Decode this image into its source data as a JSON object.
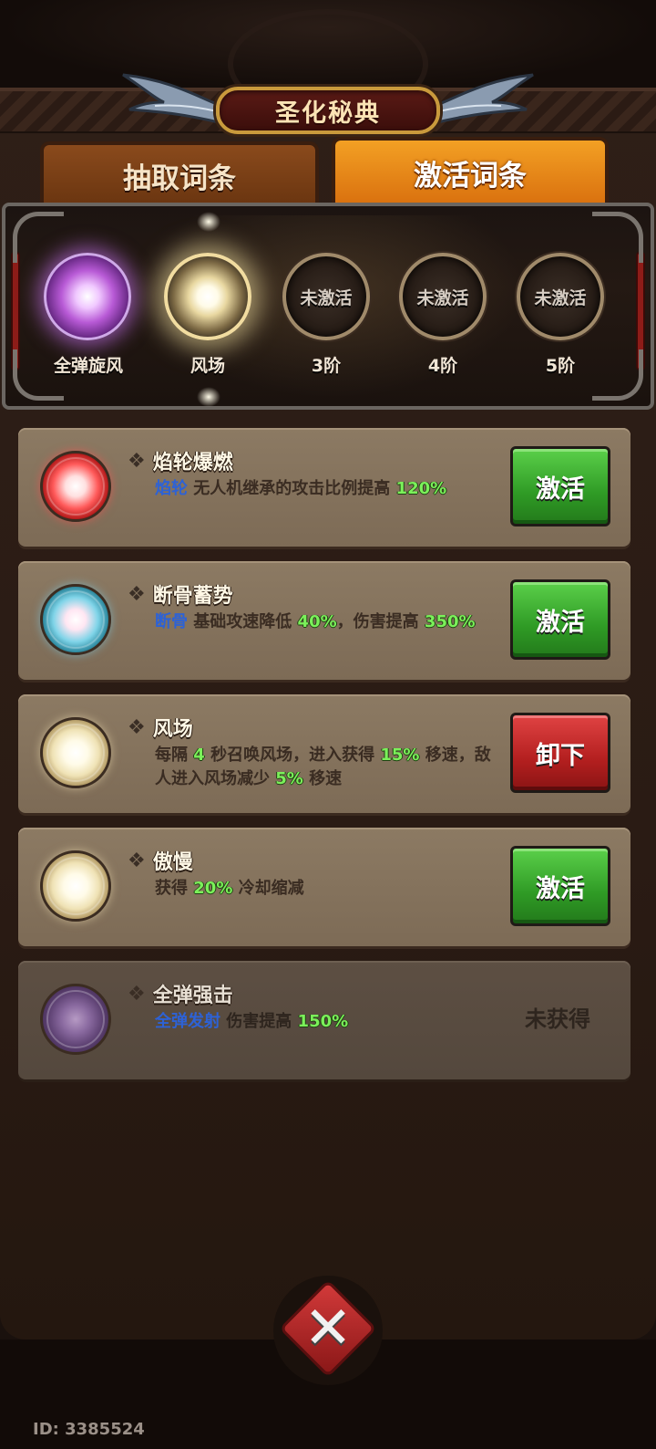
{
  "header": {
    "title": "圣化秘典"
  },
  "tabs": [
    {
      "label": "抽取词条",
      "active": false
    },
    {
      "label": "激活词条",
      "active": true
    }
  ],
  "slots": [
    {
      "label": "全弹旋风",
      "state": "filled",
      "icon": "purple-orb-icon"
    },
    {
      "label": "风场",
      "state": "filled",
      "icon": "gold-orb-icon"
    },
    {
      "label": "3阶",
      "state": "empty",
      "text": "未激活"
    },
    {
      "label": "4阶",
      "state": "empty",
      "text": "未激活"
    },
    {
      "label": "5阶",
      "state": "empty",
      "text": "未激活"
    }
  ],
  "cards": [
    {
      "icon": "red-orb-icon",
      "title": "焰轮爆燃",
      "desc_parts": [
        {
          "text": "焰轮",
          "style": "blue"
        },
        {
          "text": " 无人机继承的攻击比例提高 ",
          "style": "plain"
        },
        {
          "text": "120%",
          "style": "green"
        }
      ],
      "button": {
        "label": "激活",
        "kind": "green"
      }
    },
    {
      "icon": "cyan-orb-icon",
      "title": "断骨蓄势",
      "desc_parts": [
        {
          "text": "断骨",
          "style": "blue"
        },
        {
          "text": " 基础攻速降低 ",
          "style": "plain"
        },
        {
          "text": "40%",
          "style": "green"
        },
        {
          "text": "，伤害提高 ",
          "style": "plain"
        },
        {
          "text": "350%",
          "style": "green"
        }
      ],
      "button": {
        "label": "激活",
        "kind": "green"
      }
    },
    {
      "icon": "cream-orb-icon",
      "title": "风场",
      "desc_parts": [
        {
          "text": "每隔 ",
          "style": "plain"
        },
        {
          "text": "4",
          "style": "green"
        },
        {
          "text": " 秒召唤风场，进入获得 ",
          "style": "plain"
        },
        {
          "text": "15%",
          "style": "green"
        },
        {
          "text": " 移速，敌人进入风场减少 ",
          "style": "plain"
        },
        {
          "text": "5%",
          "style": "green"
        },
        {
          "text": " 移速",
          "style": "plain"
        }
      ],
      "button": {
        "label": "卸下",
        "kind": "red"
      }
    },
    {
      "icon": "cream-orb-icon",
      "title": "傲慢",
      "desc_parts": [
        {
          "text": "获得 ",
          "style": "plain"
        },
        {
          "text": "20%",
          "style": "green"
        },
        {
          "text": " 冷却缩减",
          "style": "plain"
        }
      ],
      "button": {
        "label": "激活",
        "kind": "green"
      }
    },
    {
      "icon": "violet-orb-icon",
      "title": "全弹强击",
      "desc_parts": [
        {
          "text": "全弹发射",
          "style": "blue"
        },
        {
          "text": " 伤害提高 ",
          "style": "plain"
        },
        {
          "text": "150%",
          "style": "green"
        }
      ],
      "status": "未获得",
      "dim": true
    }
  ],
  "footer": {
    "user_id": "ID: 3385524",
    "close_icon": "close-x-icon"
  },
  "colors": {
    "accent_orange": "#e8861a",
    "green_button": "#2f9a25",
    "red_button": "#b31f1f",
    "keyword_blue": "#2d62d6",
    "keyword_green": "#7bf05a"
  }
}
